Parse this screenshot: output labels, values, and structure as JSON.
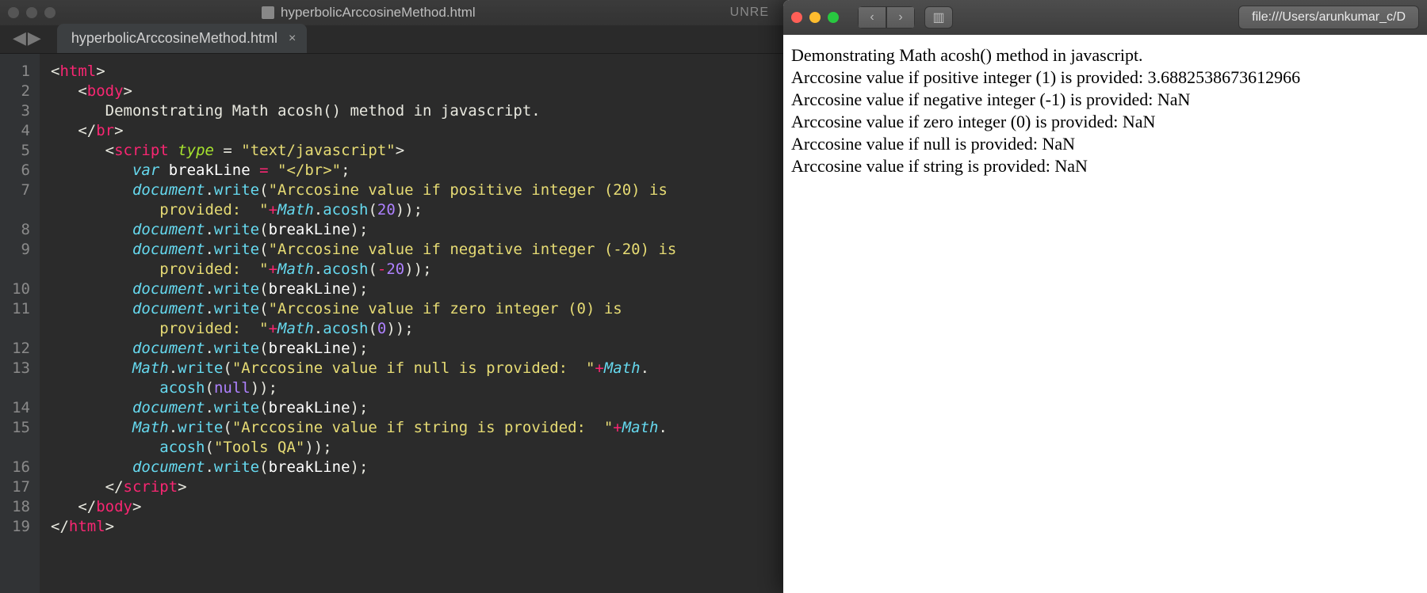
{
  "editor": {
    "window_title": "hyperbolicArccosineMethod.html",
    "unsaved_indicator": "UNRE",
    "tab": {
      "filename": "hyperbolicArccosineMethod.html",
      "close_glyph": "×"
    },
    "nav": {
      "back_glyph": "◀",
      "fwd_glyph": "▶"
    },
    "gutter_lines": [
      "1",
      "2",
      "3",
      "4",
      "5",
      "6",
      "7",
      "",
      "8",
      "9",
      "",
      "10",
      "11",
      "",
      "12",
      "13",
      "",
      "14",
      "15",
      "",
      "16",
      "17",
      "18",
      "19"
    ],
    "code": {
      "l1": {
        "open": "<",
        "tag": "html",
        "close": ">"
      },
      "l2": {
        "open": "<",
        "tag": "body",
        "close": ">"
      },
      "l3": {
        "text": "Demonstrating Math acosh() method in javascript."
      },
      "l4": {
        "open": "</",
        "tag": "br",
        "close": ">"
      },
      "l5": {
        "open": "<",
        "tag": "script",
        "attr": "type",
        "eq": " = ",
        "val": "\"text/javascript\"",
        "close": ">"
      },
      "l6": {
        "kw": "var",
        "sp": " ",
        "name": "breakLine",
        "eq": " = ",
        "val": "\"</br>\"",
        "semi": ";"
      },
      "l7a": {
        "obj": "document",
        "dot": ".",
        "fn": "write",
        "open": "(",
        "str": "\"Arccosine value if positive integer (20) is "
      },
      "l7b": {
        "str": "provided:  \"",
        "plus": "+",
        "obj": "Math",
        "dot": ".",
        "fn": "acosh",
        "open": "(",
        "num": "20",
        "close": "));"
      },
      "l8": {
        "obj": "document",
        "dot": ".",
        "fn": "write",
        "open": "(",
        "arg": "breakLine",
        "close": ");"
      },
      "l9a": {
        "obj": "document",
        "dot": ".",
        "fn": "write",
        "open": "(",
        "str": "\"Arccosine value if negative integer (-20) is "
      },
      "l9b": {
        "str": "provided:  \"",
        "plus": "+",
        "obj": "Math",
        "dot": ".",
        "fn": "acosh",
        "open": "(",
        "op": "-",
        "num": "20",
        "close": "));"
      },
      "l10": {
        "obj": "document",
        "dot": ".",
        "fn": "write",
        "open": "(",
        "arg": "breakLine",
        "close": ");"
      },
      "l11a": {
        "obj": "document",
        "dot": ".",
        "fn": "write",
        "open": "(",
        "str": "\"Arccosine value if zero integer (0) is "
      },
      "l11b": {
        "str": "provided:  \"",
        "plus": "+",
        "obj": "Math",
        "dot": ".",
        "fn": "acosh",
        "open": "(",
        "num": "0",
        "close": "));"
      },
      "l12": {
        "obj": "document",
        "dot": ".",
        "fn": "write",
        "open": "(",
        "arg": "breakLine",
        "close": ");"
      },
      "l13a": {
        "obj": "Math",
        "dot": ".",
        "fn": "write",
        "open": "(",
        "str": "\"Arccosine value if null is provided:  \"",
        "plus": "+"
      },
      "l13b": {
        "fn": "acosh",
        "open": "(",
        "arg": "null",
        "close": "));"
      },
      "l14": {
        "obj": "document",
        "dot": ".",
        "fn": "write",
        "open": "(",
        "arg": "breakLine",
        "close": ");"
      },
      "l15a": {
        "obj": "Math",
        "dot": ".",
        "fn": "write",
        "open": "(",
        "str": "\"Arccosine value if string is provided:  \"",
        "plus": "+"
      },
      "l15b": {
        "fn": "acosh",
        "open": "(",
        "str2": "\"Tools QA\"",
        "close": "));"
      },
      "l16": {
        "obj": "document",
        "dot": ".",
        "fn": "write",
        "open": "(",
        "arg": "breakLine",
        "close": ");"
      },
      "l17": {
        "open": "</",
        "tag": "script",
        "close": ">"
      },
      "l18": {
        "open": "</",
        "tag": "body",
        "close": ">"
      },
      "l19": {
        "open": "</",
        "tag": "html",
        "close": ">"
      }
    }
  },
  "browser": {
    "url": "file:///Users/arunkumar_c/D",
    "nav": {
      "back_glyph": "‹",
      "fwd_glyph": "›",
      "sidebar_glyph": "▥"
    },
    "output_lines": [
      "Demonstrating Math acosh() method in javascript.",
      "Arccosine value if positive integer (1) is provided: 3.6882538673612966",
      "Arccosine value if negative integer (-1) is provided: NaN",
      "Arccosine value if zero integer (0) is provided: NaN",
      "Arccosine value if null is provided: NaN",
      "Arccosine value if string is provided: NaN"
    ]
  }
}
